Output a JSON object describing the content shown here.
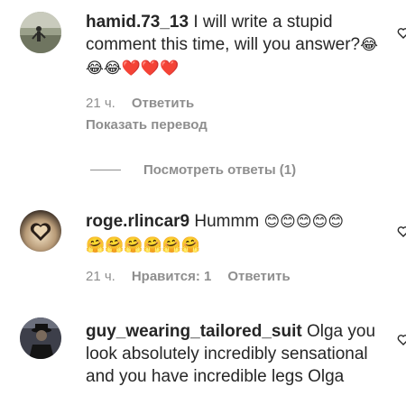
{
  "comments": [
    {
      "username": "hamid.73_13",
      "text": " I will write a stupid comment this time, will you answer?",
      "emoji": "😂😂😂❤️❤️❤️",
      "time": "21 ч.",
      "reply_label": "Ответить",
      "translate_label": "Показать перевод"
    },
    {
      "username": "roge.rlincar9",
      "text": " Hummm ",
      "emoji_line1": "😊😊😊😊😊",
      "emoji_line2": "🤗🤗🤗🤗🤗🤗",
      "time": "21 ч.",
      "likes_label": "Нравится: 1",
      "reply_label": "Ответить"
    },
    {
      "username": "guy_wearing_tailored_suit",
      "text": " Olga you look absolutely incredibly sensational and you have incredible legs Olga"
    }
  ],
  "view_replies_label": "Посмотреть ответы (1)",
  "colors": {
    "text": "#262626",
    "secondary": "#8e8e8e"
  }
}
